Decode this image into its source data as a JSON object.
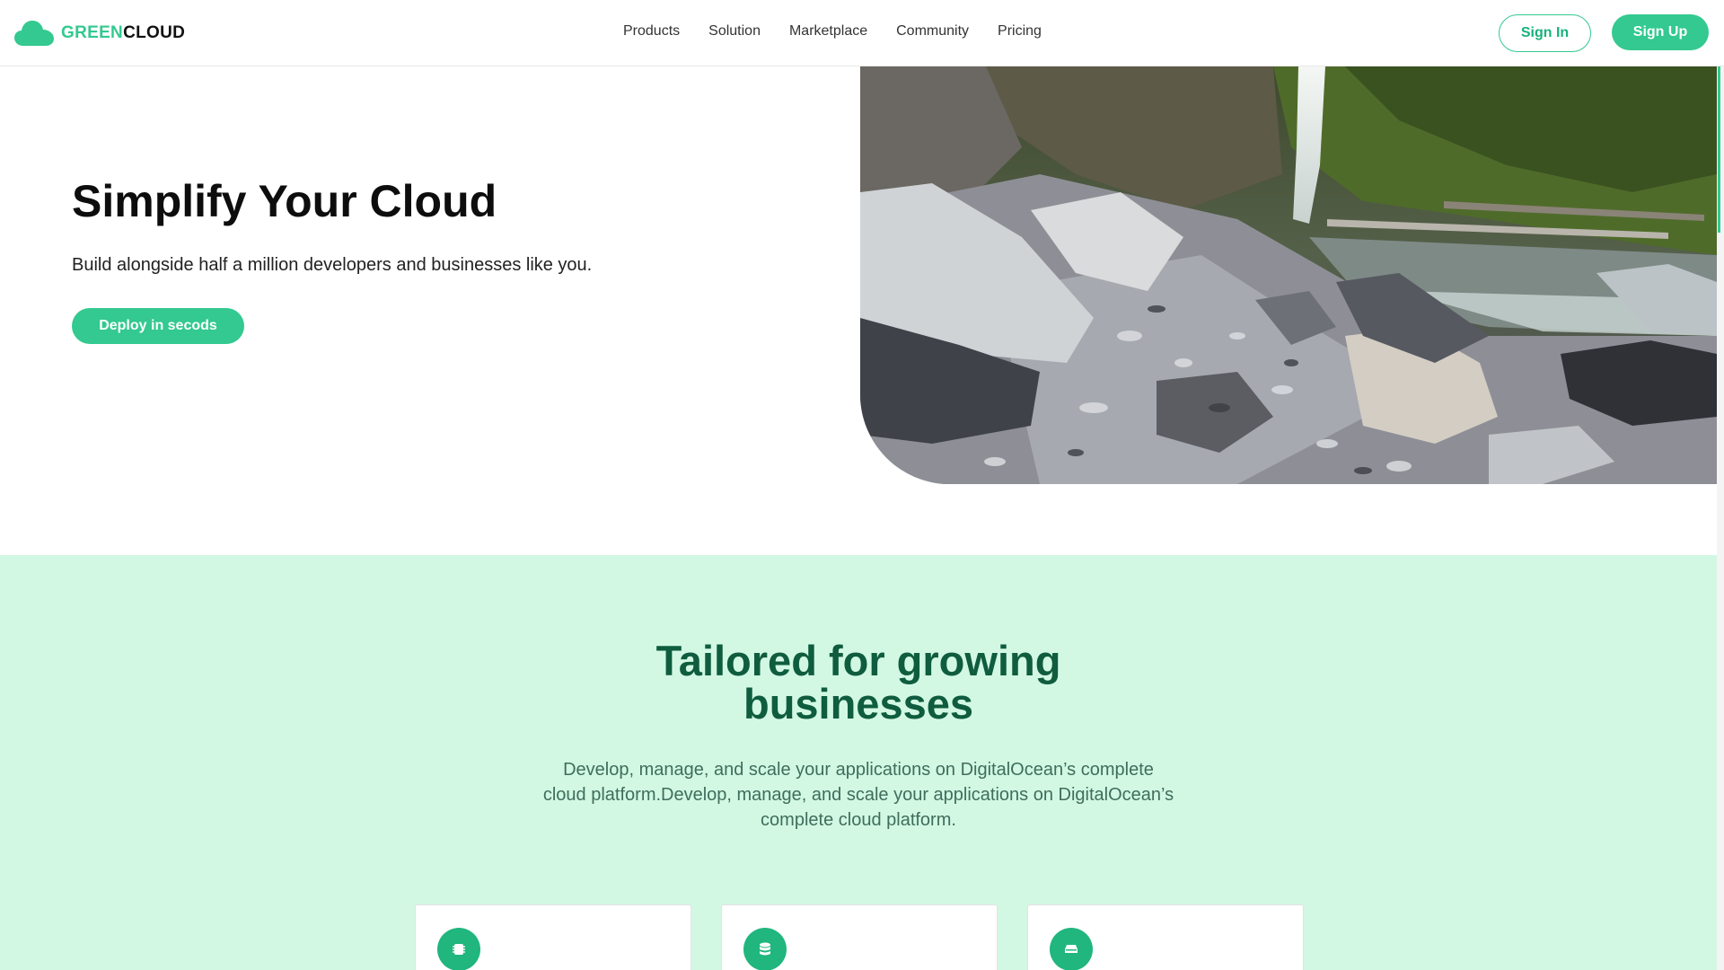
{
  "brand": {
    "part1": "GREEN",
    "part2": "CLOUD",
    "icon": "cloud-icon",
    "color": "#33c990"
  },
  "nav": {
    "items": [
      {
        "label": "Products"
      },
      {
        "label": "Solution"
      },
      {
        "label": "Marketplace"
      },
      {
        "label": "Community"
      },
      {
        "label": "Pricing"
      }
    ],
    "sign_in": "Sign In",
    "sign_up": "Sign Up"
  },
  "hero": {
    "title": "Simplify Your Cloud",
    "subtitle": "Build alongside half a million developers and businesses like you.",
    "cta": "Deploy in secods",
    "image": "waterfall-rocks-photo"
  },
  "features": {
    "title_line1": "Tailored for growing",
    "title_line2": "businesses",
    "desc_line1": "Develop, manage, and scale your applications on DigitalOcean’s complete",
    "desc_line2": "cloud platform.Develop, manage, and scale your applications on DigitalOcean’s",
    "desc_line3": "complete cloud platform.",
    "cards": [
      {
        "icon": "cpu-icon"
      },
      {
        "icon": "database-icon"
      },
      {
        "icon": "storage-icon"
      }
    ],
    "accent": "#20b67e",
    "background": "#d2f8e3"
  }
}
